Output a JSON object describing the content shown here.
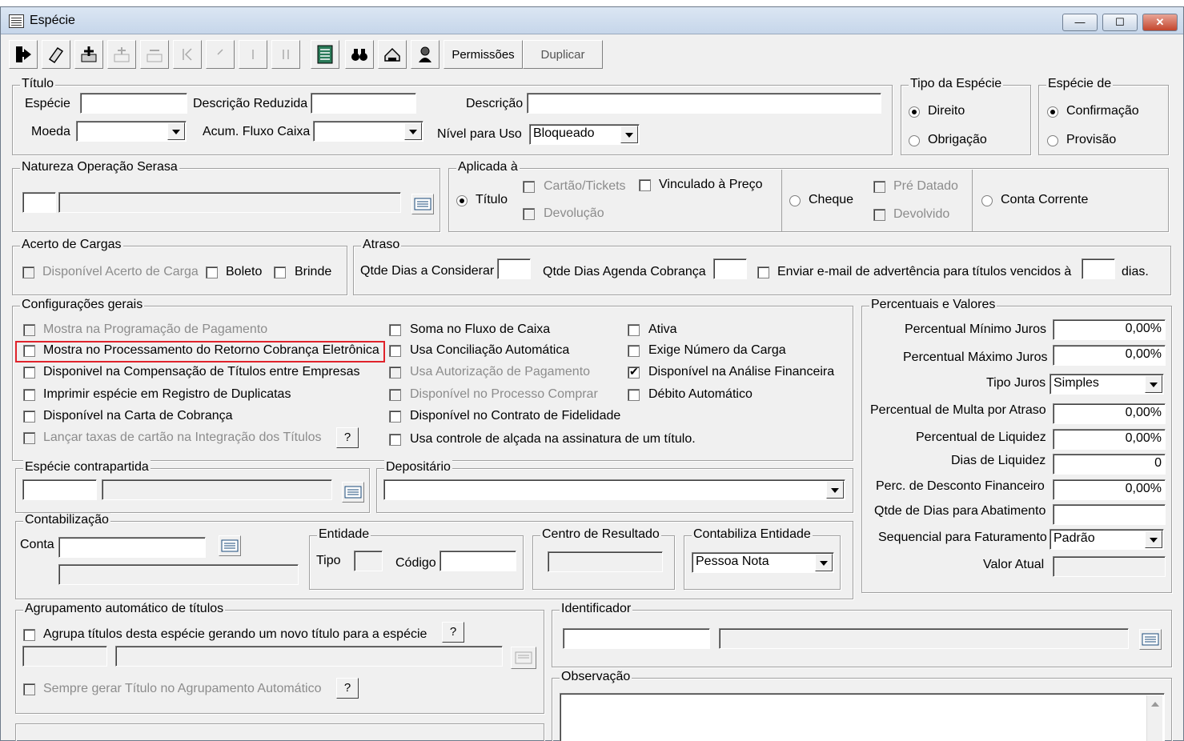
{
  "window": {
    "title": "Espécie",
    "min": "—",
    "max": "☐",
    "close": "✕"
  },
  "toolbar": {
    "permissoes": "Permissões",
    "duplicar": "Duplicar"
  },
  "titulo": {
    "legend": "Título",
    "especie": "Espécie",
    "desc_red": "Descrição Reduzida",
    "descricao": "Descrição",
    "moeda": "Moeda",
    "acum": "Acum. Fluxo Caixa",
    "nivel": "Nível para Uso",
    "nivel_val": "Bloqueado"
  },
  "tipo": {
    "legend": "Tipo da Espécie",
    "direito": "Direito",
    "obrigacao": "Obrigação"
  },
  "especie_de": {
    "legend": "Espécie de",
    "confirmacao": "Confirmação",
    "provisao": "Provisão"
  },
  "natureza": {
    "legend": "Natureza Operação Serasa"
  },
  "aplicada": {
    "legend": "Aplicada à",
    "titulo": "Título",
    "cartao": "Cartão/Tickets",
    "vinculado": "Vinculado à Preço",
    "devolucao": "Devolução",
    "cheque": "Cheque",
    "pre_datado": "Pré Datado",
    "devolvido": "Devolvido",
    "conta_corrente": "Conta Corrente"
  },
  "acerto": {
    "legend": "Acerto de Cargas",
    "disp": "Disponível Acerto de Carga",
    "boleto": "Boleto",
    "brinde": "Brinde"
  },
  "atraso": {
    "legend": "Atraso",
    "qtde": "Qtde Dias a Considerar",
    "agenda": "Qtde Dias Agenda Cobrança",
    "email": "Enviar e-mail de advertência para títulos vencidos à",
    "dias": "dias."
  },
  "config": {
    "legend": "Configurações gerais",
    "c1": "Mostra na Programação de Pagamento",
    "c2": "Mostra no Processamento do Retorno Cobrança Eletrônica",
    "c3": "Disponivel na Compensação de Títulos entre Empresas",
    "c4": "Imprimir espécie em Registro de Duplicatas",
    "c5": "Disponível na Carta de Cobrança",
    "c6": "Lançar taxas de cartão na Integração dos Títulos",
    "c7": "Soma no Fluxo de Caixa",
    "c8": "Usa Conciliação Automática",
    "c9": "Usa Autorização de Pagamento",
    "c10": "Disponível no Processo Comprar",
    "c11": "Disponível no Contrato de Fidelidade",
    "c12": "Usa controle de alçada na assinatura de um título.",
    "c13": "Ativa",
    "c14": "Exige Número da Carga",
    "c15": "Disponível na Análise Financeira",
    "c16": "Débito Automático",
    "q": "?"
  },
  "perc": {
    "legend": "Percentuais e Valores",
    "min": "Percentual Mínimo Juros",
    "min_v": "0,00%",
    "max": "Percentual Máximo Juros",
    "max_v": "0,00%",
    "tipo": "Tipo Juros",
    "tipo_v": "Simples",
    "multa": "Percentual de Multa por Atraso",
    "multa_v": "0,00%",
    "liq": "Percentual de Liquidez",
    "liq_v": "0,00%",
    "dias": "Dias de Liquidez",
    "dias_v": "0",
    "desc": "Perc. de Desconto Financeiro",
    "desc_v": "0,00%",
    "abat": "Qtde de Dias para Abatimento",
    "seq": "Sequencial para Faturamento",
    "seq_v": "Padrão",
    "valor": "Valor Atual"
  },
  "contra": {
    "legend": "Espécie contrapartida"
  },
  "deposit": {
    "legend": "Depositário"
  },
  "contab": {
    "legend": "Contabilização",
    "conta": "Conta",
    "entidade": "Entidade",
    "tipo": "Tipo",
    "codigo": "Código",
    "centro": "Centro de Resultado",
    "contab_ent": "Contabiliza Entidade",
    "contab_ent_v": "Pessoa Nota"
  },
  "agrup": {
    "legend": "Agrupamento automático de títulos",
    "a1": "Agrupa títulos desta espécie gerando um novo título para a espécie",
    "a2": "Sempre gerar Título no  Agrupamento Automático",
    "q": "?"
  },
  "ident": {
    "legend": "Identificador"
  },
  "obs": {
    "legend": "Observação"
  }
}
